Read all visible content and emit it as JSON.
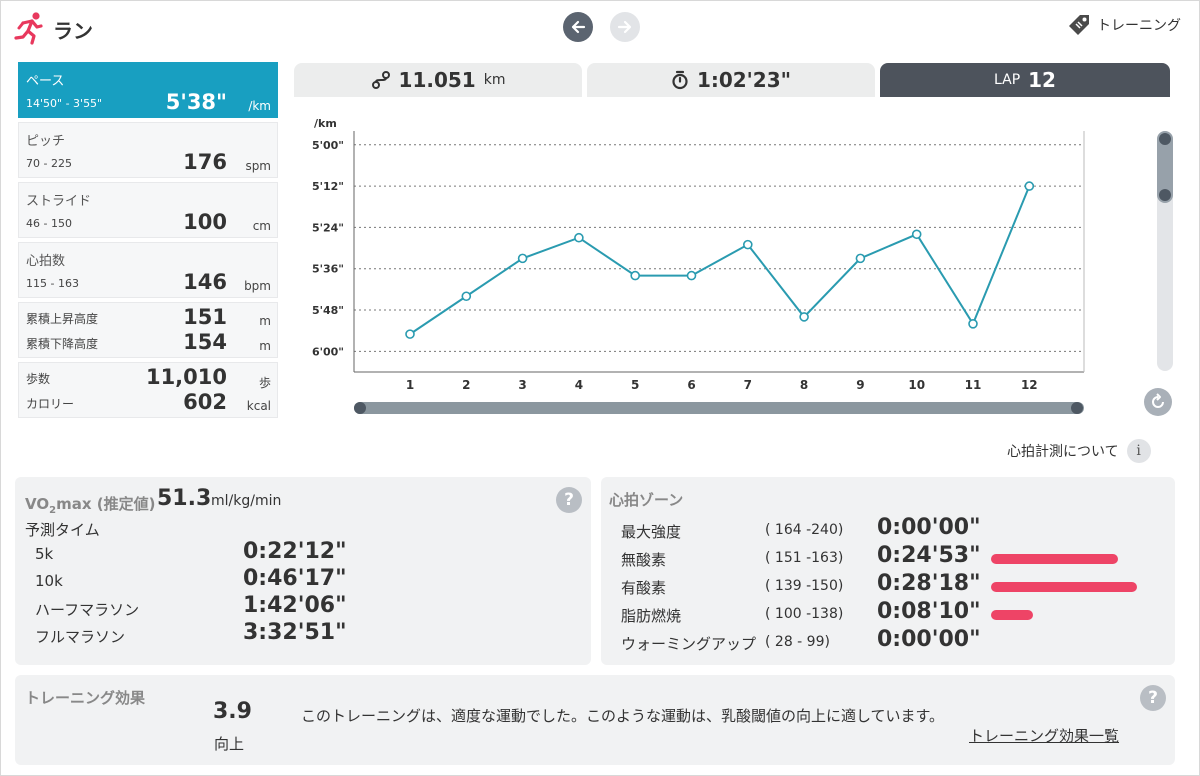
{
  "header": {
    "title": "ラン",
    "training_link": "トレーニング",
    "accent": "#e8385d"
  },
  "metrics": {
    "pace": {
      "label": "ペース",
      "range": "14'50\" - 3'55\"",
      "value": "5'38\"",
      "unit": "/km"
    },
    "pitch": {
      "label": "ピッチ",
      "range": "70 - 225",
      "value": "176",
      "unit": "spm"
    },
    "stride": {
      "label": "ストライド",
      "range": "46 - 150",
      "value": "100",
      "unit": "cm"
    },
    "heart_rate": {
      "label": "心拍数",
      "range": "115 - 163",
      "value": "146",
      "unit": "bpm"
    },
    "ascent": {
      "label": "累積上昇高度",
      "value": "151",
      "unit": "m"
    },
    "descent": {
      "label": "累積下降高度",
      "value": "154",
      "unit": "m"
    },
    "steps": {
      "label": "歩数",
      "value": "11,010",
      "unit": "歩"
    },
    "calories": {
      "label": "カロリー",
      "value": "602",
      "unit": "kcal"
    }
  },
  "tabs": {
    "distance": {
      "value": "11.051",
      "unit": "km"
    },
    "time": {
      "value": "1:02'23\""
    },
    "lap": {
      "label": "LAP",
      "value": "12"
    }
  },
  "chart_data": {
    "type": "line",
    "ylabel": "/km",
    "x": [
      1,
      2,
      3,
      4,
      5,
      6,
      7,
      8,
      9,
      10,
      11,
      12
    ],
    "categories": [
      "1",
      "2",
      "3",
      "4",
      "5",
      "6",
      "7",
      "8",
      "9",
      "10",
      "11",
      "12"
    ],
    "y_ticks_seconds": [
      300,
      312,
      324,
      336,
      348,
      360
    ],
    "y_tick_labels": [
      "5'00\"",
      "5'12\"",
      "5'24\"",
      "5'36\"",
      "5'48\"",
      "6'00\""
    ],
    "values_seconds": [
      355,
      344,
      333,
      327,
      338,
      338,
      329,
      350,
      333,
      326,
      352,
      312
    ],
    "ylim_seconds": [
      296,
      366
    ],
    "y_inverted": true,
    "grid": true,
    "line_color": "#2a9bb0"
  },
  "hr_about": "心拍計測について",
  "vo2": {
    "label": "VO",
    "label_sub": "2",
    "label_rest": "max (推定値)",
    "value": "51.3",
    "unit": "ml/kg/min",
    "prediction_title": "予測タイム",
    "predictions": [
      {
        "name": "5k",
        "time": "0:22'12\""
      },
      {
        "name": "10k",
        "time": "0:46'17\""
      },
      {
        "name": "ハーフマラソン",
        "time": "1:42'06\""
      },
      {
        "name": "フルマラソン",
        "time": "3:32'51\""
      }
    ]
  },
  "hr_zones": {
    "title": "心拍ゾーン",
    "bar_color": "#ee4466",
    "zones": [
      {
        "name": "最大強度",
        "range": "( 164 -240)",
        "time": "0:00'00\"",
        "level": 0
      },
      {
        "name": "無酸素",
        "range": "( 151 -163)",
        "time": "0:24'53\"",
        "level": 0.87
      },
      {
        "name": "有酸素",
        "range": "( 139 -150)",
        "time": "0:28'18\"",
        "level": 1.0
      },
      {
        "name": "脂肪燃焼",
        "range": "( 100 -138)",
        "time": "0:08'10\"",
        "level": 0.29
      },
      {
        "name": "ウォーミングアップ",
        "range": "( 28 -  99)",
        "time": "0:00'00\"",
        "level": 0
      }
    ]
  },
  "training_effect": {
    "title": "トレーニング効果",
    "value": "3.9",
    "level": "向上",
    "description": "このトレーニングは、適度な運動でした。このような運動は、乳酸閾値の向上に適しています。",
    "link": "トレーニング効果一覧"
  },
  "help_symbol": "?",
  "info_symbol": "i"
}
